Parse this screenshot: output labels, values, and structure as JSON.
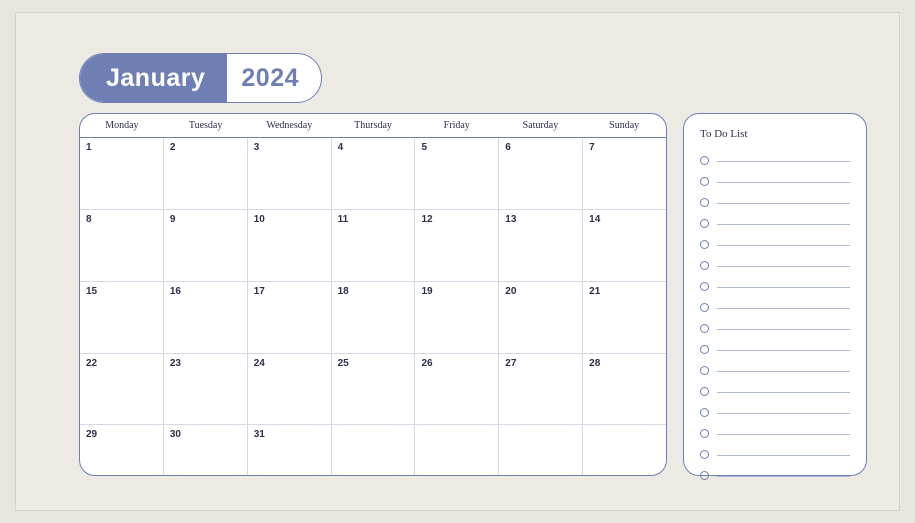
{
  "month": {
    "name": "January",
    "year": "2024"
  },
  "weekdays": [
    "Monday",
    "Tuesday",
    "Wednesday",
    "Thursday",
    "Friday",
    "Saturday",
    "Sunday"
  ],
  "weeks": [
    [
      "1",
      "2",
      "3",
      "4",
      "5",
      "6",
      "7"
    ],
    [
      "8",
      "9",
      "10",
      "11",
      "12",
      "13",
      "14"
    ],
    [
      "15",
      "16",
      "17",
      "18",
      "19",
      "20",
      "21"
    ],
    [
      "22",
      "23",
      "24",
      "25",
      "26",
      "27",
      "28"
    ],
    [
      "29",
      "30",
      "31",
      "",
      "",
      "",
      ""
    ]
  ],
  "todo": {
    "title": "To Do List",
    "rows": 16
  }
}
